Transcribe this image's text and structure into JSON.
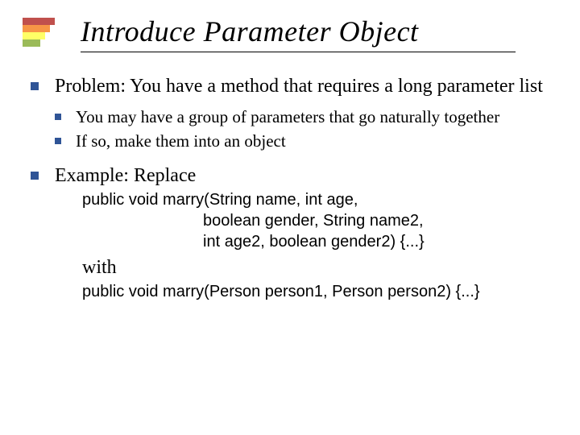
{
  "title": "Introduce Parameter Object",
  "bullets": {
    "problem": "Problem: You have a method that requires a long parameter list",
    "sub1": "You may have a group of parameters that go naturally together",
    "sub2": "If so, make them into an object",
    "example": "Example: Replace"
  },
  "code": {
    "before1": "public void marry(String name, int age,",
    "before2": "                           boolean gender, String name2,",
    "before3": "                           int age2, boolean gender2) {...}",
    "with": "with",
    "after": "public void marry(Person person1, Person person2) {...}"
  }
}
